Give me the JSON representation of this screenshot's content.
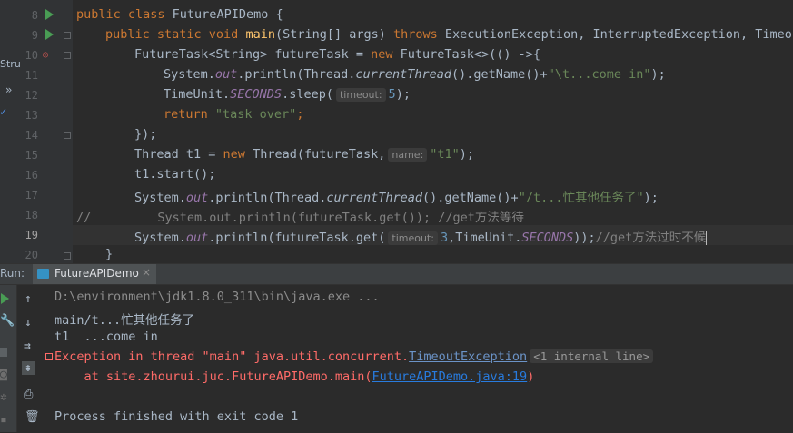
{
  "editor": {
    "lines": [
      {
        "num": "8"
      },
      {
        "num": "9"
      },
      {
        "num": "10"
      },
      {
        "num": "11"
      },
      {
        "num": "12"
      },
      {
        "num": "13"
      },
      {
        "num": "14"
      },
      {
        "num": "15"
      },
      {
        "num": "16"
      },
      {
        "num": "17"
      },
      {
        "num": "18"
      },
      {
        "num": "19"
      },
      {
        "num": "20"
      }
    ],
    "l8": {
      "kw": "public class ",
      "name": "FutureAPIDemo {"
    },
    "l9": {
      "kw": "public static void ",
      "fn": "main",
      "rest": "(String[] args) ",
      "throws": "throws ",
      "tail": "ExecutionException, InterruptedException, Timeout"
    },
    "l10": {
      "a": "FutureTask<String> futureTask = ",
      "new": "new ",
      "b": "FutureTask<>(() ->{"
    },
    "l11": {
      "a": "System.",
      "out": "out",
      "b": ".println(Thread.",
      "ct": "currentThread",
      "c": "().getName()+",
      "s": "\"\\t...come in\"",
      "d": ");"
    },
    "l12": {
      "a": "TimeUnit.",
      "sec": "SECONDS",
      "b": ".sleep(",
      "hint": "timeout:",
      "n": "5",
      "c": ");"
    },
    "l13": {
      "ret": "return ",
      "s": "\"task over\"",
      "c": ";"
    },
    "l14": {
      "a": "});"
    },
    "l15": {
      "a": "Thread t1 = ",
      "new": "new ",
      "b": "Thread(futureTask,",
      "hint": "name:",
      "s": "\"t1\"",
      "c": ");"
    },
    "l16": {
      "a": "t1.start();"
    },
    "l17": {
      "a": "System.",
      "out": "out",
      "b": ".println(Thread.",
      "ct": "currentThread",
      "c": "().getName()+",
      "s": "\"/t...忙其他任务了\"",
      "d": ");"
    },
    "l18": {
      "a": "//         System.out.println(futureTask.get()); //get方法等待"
    },
    "l19": {
      "a": "System.",
      "out": "out",
      "b": ".println(futureTask.get(",
      "hint": "timeout:",
      "n": "3",
      "c": ",TimeUnit.",
      "sec": "SECONDS",
      "d": "));",
      "cm": "//get方法过时不候"
    },
    "l20": {
      "a": "}"
    }
  },
  "left_fragments": {
    "stru": "Stru",
    "chev": "»"
  },
  "run": {
    "label": "Run:",
    "tab": "FutureAPIDemo",
    "close": "×"
  },
  "console": {
    "c1": "D:\\environment\\jdk1.8.0_311\\bin\\java.exe ...",
    "c2": "main/t...忙其他任务了",
    "c3": "t1  ...come in",
    "c4a": "Exception in thread \"main\" java.util.concurrent.",
    "c4link": "TimeoutException",
    "c4hint": "<1 internal line>",
    "c5a": "    at site.zhourui.juc.FutureAPIDemo.main(",
    "c5link": "FutureAPIDemo.java:19",
    "c5b": ")",
    "c6": "Process finished with exit code 1"
  },
  "colors": {
    "bg": "#2b2b2b",
    "keyword": "#cc7832",
    "string": "#6a8759",
    "error": "#ff6b68"
  }
}
